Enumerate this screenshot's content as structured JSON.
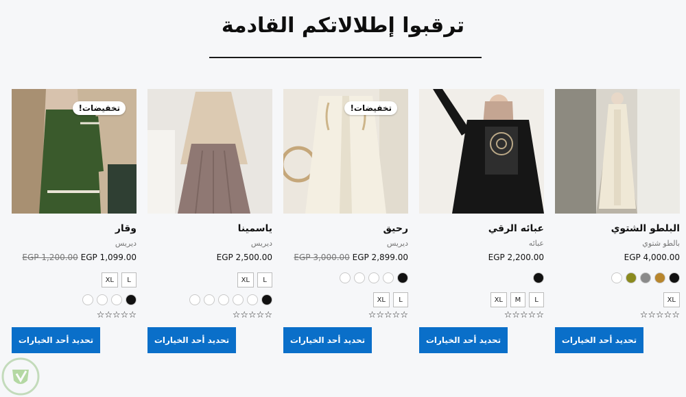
{
  "section": {
    "title": "ترقبوا إطلالاتكم القادمة"
  },
  "button_label": "تحديد أحد الخيارات",
  "rating_stars": "☆☆☆☆☆",
  "colors": {
    "button": "#0a6fc9",
    "background": "#f6f7f9"
  },
  "products": [
    {
      "name": "البلطو الشتوي",
      "category": "بالطو شتوي",
      "price": "EGP 4,000.00",
      "old_price": "",
      "badge": "",
      "sizes": [
        "XL"
      ],
      "swatches": [
        "#111111",
        "#b8862d",
        "#8a8a8a",
        "#8a8a1e",
        "#ffffff"
      ]
    },
    {
      "name": "عبائه الرقي",
      "category": "عبائه",
      "price": "EGP 2,200.00",
      "old_price": "",
      "badge": "",
      "sizes": [
        "L",
        "M",
        "XL"
      ],
      "swatches": [
        "#111111"
      ]
    },
    {
      "name": "رحيق",
      "category": "ديريس",
      "price": "EGP 2,899.00",
      "old_price": "EGP 3,000.00",
      "badge": "تخفيضات!",
      "sizes": [
        "L",
        "XL"
      ],
      "swatches": [
        "#111111",
        "#ffffff",
        "#ffffff",
        "#ffffff",
        "#ffffff"
      ]
    },
    {
      "name": "ياسمينا",
      "category": "ديريس",
      "price": "EGP 2,500.00",
      "old_price": "",
      "badge": "",
      "sizes": [
        "L",
        "XL"
      ],
      "swatches": [
        "#111111",
        "#ffffff",
        "#ffffff",
        "#ffffff",
        "#ffffff",
        "#ffffff"
      ]
    },
    {
      "name": "وقار",
      "category": "ديريس",
      "price": "EGP 1,099.00",
      "old_price": "EGP 1,200.00",
      "badge": "تخفيضات!",
      "sizes": [
        "L",
        "XL"
      ],
      "swatches": [
        "#111111",
        "#ffffff",
        "#ffffff",
        "#ffffff"
      ]
    }
  ]
}
